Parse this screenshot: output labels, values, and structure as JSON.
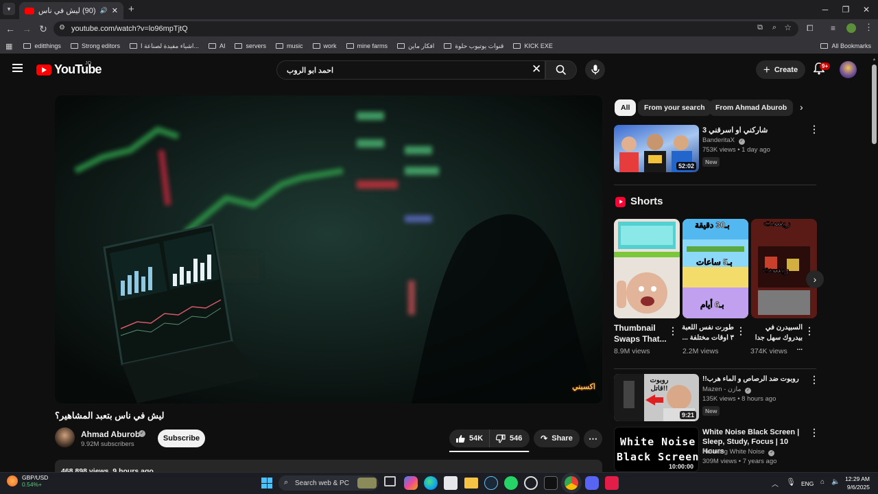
{
  "browser": {
    "tab_title": "(90) ليش في ناس بتعبد المشاهير؟",
    "url": "youtube.com/watch?v=lo96mpTjtQ",
    "all_bookmarks": "All Bookmarks",
    "bookmarks": [
      "editthings",
      "Strong editors",
      "اشياء مفيدة لصناعة ا...",
      "AI",
      "servers",
      "music",
      "work",
      "mine farms",
      "افكار ماين",
      "قنوات يوتيوب حلوة",
      "KICK EXE"
    ]
  },
  "youtube": {
    "logo_text": "YouTube",
    "country": "JO",
    "search_query": "احمد ابو الروب",
    "create_label": "Create",
    "notif_count": "9+"
  },
  "video": {
    "title": "ليش في ناس بتعبد المشاهير؟",
    "watermark": "اكسبني",
    "channel": "Ahmad Aburob",
    "subscribers": "9.92M subscribers",
    "subscribe_label": "Subscribe",
    "likes": "54K",
    "dislikes": "546",
    "share_label": "Share",
    "stats_partial": "468,898 views  9 hours ago"
  },
  "sidebar": {
    "chips": [
      "All",
      "From your search",
      "From Ahmad Aburob"
    ],
    "rec1": {
      "title": "شاركني او اسرقني 3",
      "channel": "BanderitaX",
      "meta": "753K views • 1 day ago",
      "badge": "New",
      "duration": "52:02"
    },
    "shorts_heading": "Shorts",
    "shorts": [
      {
        "title": "Thumbnail Swaps That...",
        "views": "8.9M views"
      },
      {
        "title": "طورت نفس اللعبة ٣ اوقات مختلفة ...",
        "views": "2.2M views",
        "overlay1": "بـ30 دقيقة",
        "overlay2": "بـ5 ساعات",
        "overlay3": "بـ6 أيام"
      },
      {
        "title": "السبيدرن في بيدروك سهل جدا ...",
        "views": "374K views",
        "overlay1": "ريست",
        "overlay2": "ريست"
      }
    ],
    "rec2": {
      "title": "روبوت ضد الرصاص و الماء هرب!!",
      "channel": "Mazen - مازن",
      "meta": "135K views • 8 hours ago",
      "badge": "New",
      "duration": "9:21",
      "thumb_text": "روبوت قاتل!!"
    },
    "rec3": {
      "title": "White Noise Black Screen | Sleep, Study, Focus | 10 Hours",
      "channel": "Relaxing White Noise",
      "meta": "309M views • 7 years ago",
      "duration": "10:00:00",
      "thumb_line1": "White Noise",
      "thumb_line2": "Black Screen"
    }
  },
  "taskbar": {
    "ticker": "GBP/USD",
    "ticker_change": "0.54%+",
    "search_label": "Search web & PC",
    "lang": "ENG",
    "time": "12:29 AM",
    "date": "9/6/2025"
  }
}
